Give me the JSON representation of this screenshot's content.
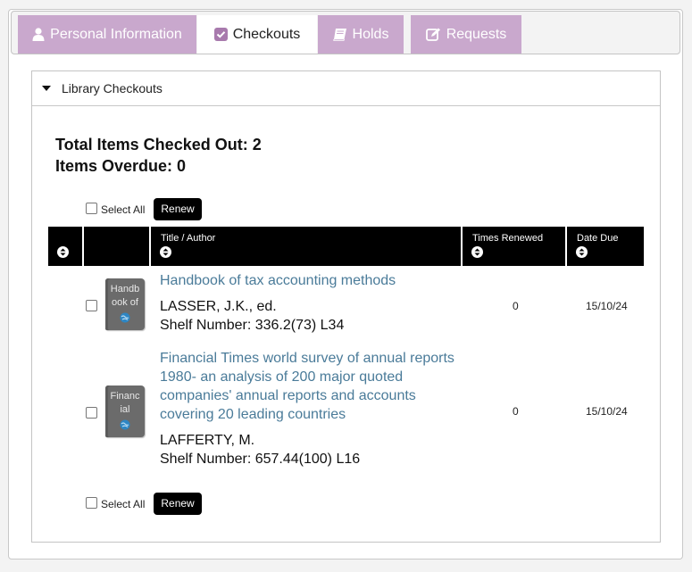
{
  "tabs": [
    {
      "label": "Personal Information",
      "icon": "user-icon",
      "active": false
    },
    {
      "label": "Checkouts",
      "icon": "checkbox-checked-icon",
      "active": true
    },
    {
      "label": "Holds",
      "icon": "book-icon",
      "active": false
    },
    {
      "label": "Requests",
      "icon": "edit-icon",
      "active": false
    }
  ],
  "section": {
    "title": "Library Checkouts",
    "expanded": true
  },
  "summary": {
    "total_label": "Total Items Checked Out: 2",
    "overdue_label": "Items Overdue: 0"
  },
  "controls": {
    "select_all_label": "Select All",
    "renew_label": "Renew"
  },
  "table": {
    "columns": [
      "",
      "",
      "Title / Author",
      "Times Renewed",
      "Date Due"
    ],
    "rows": [
      {
        "cover_text": "Handb ook of",
        "title": "Handbook of tax accounting methods",
        "author": "LASSER, J.K., ed.",
        "shelf": "Shelf Number: 336.2(73) L34",
        "times_renewed": "0",
        "date_due": "15/10/24"
      },
      {
        "cover_text": "Financ ial",
        "title": "Financial Times world survey of annual reports 1980- an analysis of 200 major quoted companies' annual reports and accounts covering 20 leading countries",
        "author": "LAFFERTY, M.",
        "shelf": "Shelf Number: 657.44(100) L16",
        "times_renewed": "0",
        "date_due": "15/10/24"
      }
    ]
  },
  "colors": {
    "tab_bg": "#c9a8cd",
    "link": "#4a7b99",
    "header_bg": "#000000",
    "page_bg": "#f3f3f3"
  }
}
